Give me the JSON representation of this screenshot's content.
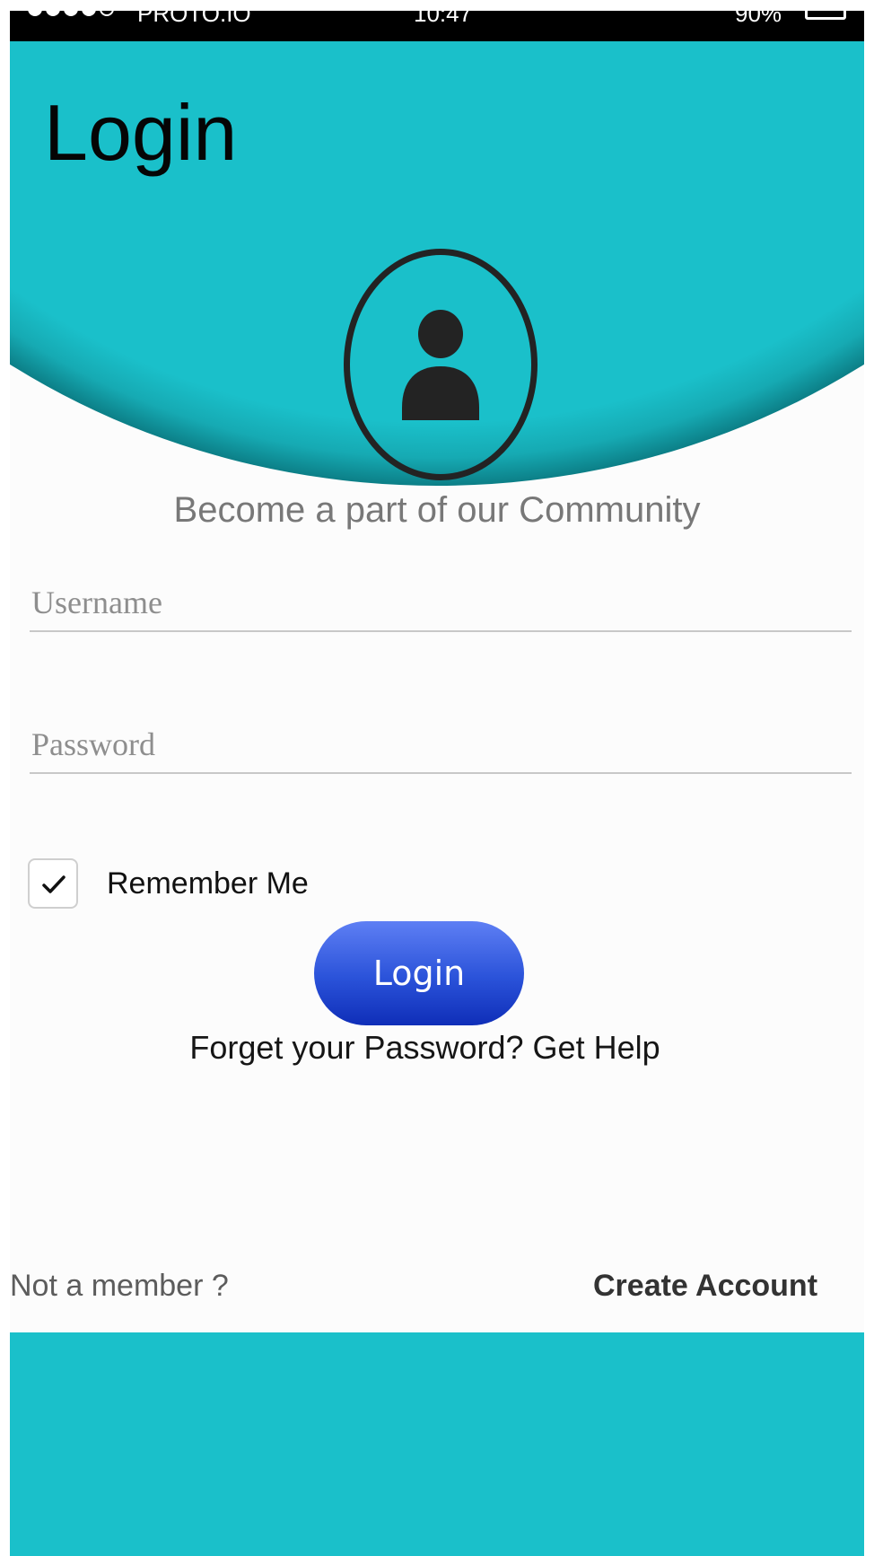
{
  "status_bar": {
    "carrier": "PROTO.IO",
    "time": "10:47",
    "battery": "90%",
    "signal_icon": "signal-dots-icon",
    "battery_icon": "battery-icon"
  },
  "header": {
    "title": "Login",
    "avatar_icon": "user-icon"
  },
  "tagline": "Become a part of our Community",
  "form": {
    "username_placeholder": "Username",
    "username_value": "",
    "password_placeholder": "Password",
    "password_value": "",
    "remember_label": "Remember Me",
    "remember_checked": true,
    "login_button": "Login",
    "forgot_link": "Forget your Password? Get Help"
  },
  "footer": {
    "not_member": "Not a member  ?",
    "create_account": "Create Account"
  },
  "colors": {
    "teal": "#1ac0ca",
    "button_blue": "#2a52d9",
    "text_dark": "#111111",
    "text_gray": "#787878"
  }
}
